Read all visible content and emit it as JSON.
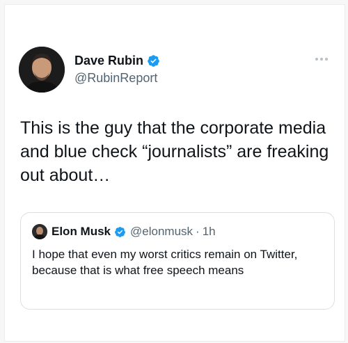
{
  "tweet": {
    "author_name": "Dave Rubin",
    "author_handle": "@RubinReport",
    "text": "This is the guy that the corporate media and blue check “journalists” are freaking out about…",
    "more_icon": "more-horizontal-icon",
    "verified_icon": "verified-badge-icon"
  },
  "quoted_tweet": {
    "author_name": "Elon Musk",
    "author_handle": "@elonmusk",
    "separator": "·",
    "time": "1h",
    "text": "I hope that even my worst critics remain on Twitter, because that is what free speech means"
  },
  "colors": {
    "verified_blue": "#1d9bf0",
    "secondary_text": "#536471",
    "border": "#dcdfe2"
  }
}
